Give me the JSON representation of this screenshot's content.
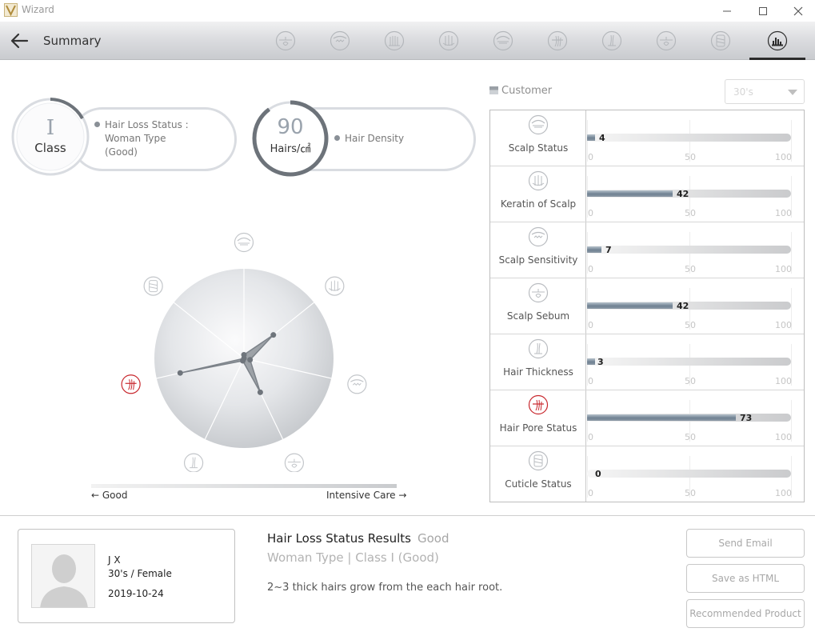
{
  "window": {
    "title": "Wizard"
  },
  "header": {
    "title": "Summary",
    "tabs": [
      {
        "icon": "scalp-sebum-icon",
        "active": false
      },
      {
        "icon": "scalp-sensitivity-icon",
        "active": false
      },
      {
        "icon": "hair-density-icon",
        "active": false
      },
      {
        "icon": "keratin-icon",
        "active": false
      },
      {
        "icon": "scalp-status-icon",
        "active": false
      },
      {
        "icon": "hair-pore-icon",
        "active": false
      },
      {
        "icon": "hair-thickness-icon",
        "active": false
      },
      {
        "icon": "scalp-sebum-icon",
        "active": false
      },
      {
        "icon": "cuticle-icon",
        "active": false
      },
      {
        "icon": "summary-chart-icon",
        "active": true
      }
    ]
  },
  "status": {
    "class_value": "I",
    "class_label": "Class",
    "hair_loss_label": "Hair Loss Status  :",
    "hair_loss_line2": "Woman Type",
    "hair_loss_line3": "(Good)",
    "density_value": "90",
    "density_unit": "Hairs/㎠",
    "density_label": "Hair Density"
  },
  "scale": {
    "left": "Good",
    "right": "Intensive Care"
  },
  "customer": {
    "label": "Customer",
    "age_select": "30's"
  },
  "metrics": {
    "max": 100,
    "ticks": [
      "0",
      "50",
      "100"
    ],
    "items": [
      {
        "name": "Scalp Status",
        "value": 4,
        "icon": "scalp-status-icon",
        "highlight": false
      },
      {
        "name": "Keratin of Scalp",
        "value": 42,
        "icon": "keratin-icon",
        "highlight": false
      },
      {
        "name": "Scalp Sensitivity",
        "value": 7,
        "icon": "scalp-sensitivity-icon",
        "highlight": false
      },
      {
        "name": "Scalp Sebum",
        "value": 42,
        "icon": "scalp-sebum-icon",
        "highlight": false
      },
      {
        "name": "Hair Thickness",
        "value": 3,
        "icon": "hair-thickness-icon",
        "highlight": false
      },
      {
        "name": "Hair Pore Status",
        "value": 73,
        "icon": "hair-pore-icon",
        "highlight": true
      },
      {
        "name": "Cuticle Status",
        "value": 0,
        "icon": "cuticle-icon",
        "highlight": false
      }
    ]
  },
  "profile": {
    "name": "J X",
    "age_gender": "30's / Female",
    "date": "2019-10-24"
  },
  "result": {
    "title": "Hair Loss Status Results",
    "grade": "Good",
    "type": "Woman Type | Class I (Good)",
    "description": "2~3 thick hairs grow from the each hair root."
  },
  "actions": {
    "send_email": "Send Email",
    "save_html": "Save as HTML",
    "recommended": "Recommended Product"
  },
  "colors": {
    "accent": "#c8272d",
    "bar": "#6f8192",
    "ring": "#6d737a"
  }
}
